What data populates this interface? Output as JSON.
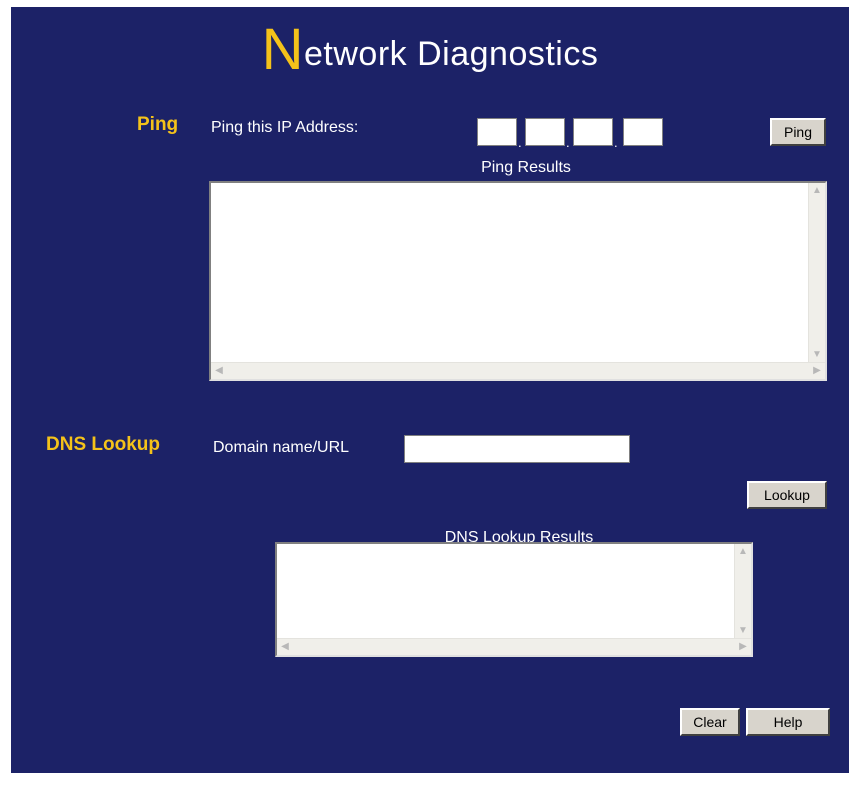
{
  "title": {
    "first_letter": "N",
    "rest": "etwork Diagnostics"
  },
  "ping": {
    "section_label": "Ping",
    "field_label": "Ping this IP Address:",
    "octets": [
      "",
      "",
      "",
      ""
    ],
    "dot": ".",
    "button_label": "Ping",
    "results_heading": "Ping Results",
    "results_text": ""
  },
  "dns": {
    "section_label": "DNS Lookup",
    "field_label": "Domain name/URL",
    "domain_value": "",
    "button_label": "Lookup",
    "results_heading": "DNS Lookup Results",
    "results_text": ""
  },
  "footer": {
    "clear_label": "Clear",
    "help_label": "Help"
  },
  "colors": {
    "background": "#1c2267",
    "accent": "#f4c21a",
    "text": "#ffffff"
  }
}
